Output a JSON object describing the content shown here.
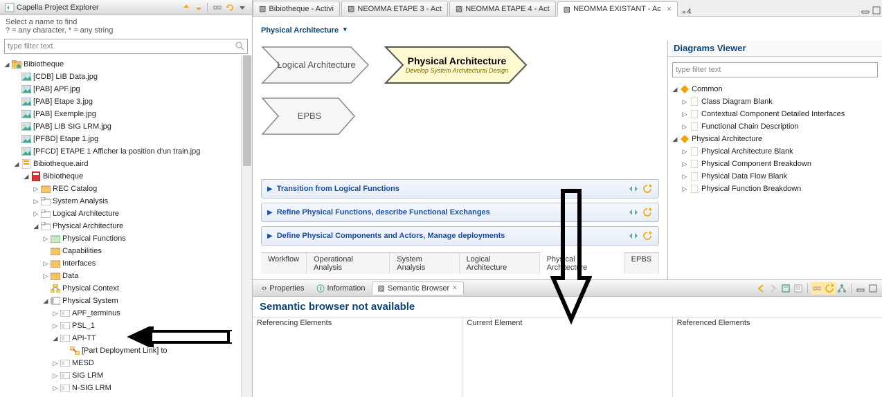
{
  "sidebar": {
    "title": "Capella Project Explorer",
    "help1": "Select a name to find",
    "help2": "? = any character, * = any string",
    "filter_placeholder": "type filter text",
    "tree": {
      "root": "Bibiotheque",
      "imgs": [
        "[CDB] LIB Data.jpg",
        "[PAB] APF.jpg",
        "[PAB] Etape 3.jpg",
        "[PAB] Exemple.jpg",
        "[PAB] LIB SIG LRM.jpg",
        "[PFBD] Etape 1.jpg",
        "[PFCD] ETAPE 1 Afficher la position d'un train.jpg"
      ],
      "aird": "Bibiotheque.aird",
      "model": "Bibiotheque",
      "rec": "REC Catalog",
      "sa": "System Analysis",
      "la": "Logical Architecture",
      "pa": "Physical Architecture",
      "pf": "Physical Functions",
      "cap": "Capabilities",
      "ifc": "Interfaces",
      "data": "Data",
      "pctx": "Physical Context",
      "psys": "Physical System",
      "apf": "APF_terminus",
      "psl": "PSL_1",
      "api": "API-TT",
      "pdl": "[Part Deployment Link] to",
      "mesd": "MESD",
      "sig": "SIG LRM",
      "nsig": "N-SIG LRM"
    }
  },
  "editor": {
    "tabs": [
      "Bibiotheque - Activi",
      "NEOMMA ETAPE 3 - Act",
      "NEOMMA ETAPE 4 - Act",
      "NEOMMA EXISTANT - Ac"
    ],
    "overflow": "4",
    "title": "Physical Architecture",
    "chevrons": {
      "logical": "Logical Architecture",
      "physical_t": "Physical Architecture",
      "physical_s": "Develop System Architectural Design",
      "epbs": "EPBS"
    },
    "acc": [
      "Transition from Logical Functions",
      "Refine Physical Functions, describe Functional Exchanges",
      "Define Physical Components and Actors, Manage deployments"
    ],
    "btabs": [
      "Workflow",
      "Operational Analysis",
      "System Analysis",
      "Logical Architecture",
      "Physical Architecture",
      "EPBS"
    ]
  },
  "diagrams": {
    "title": "Diagrams Viewer",
    "filter_placeholder": "type filter text",
    "common": "Common",
    "c1": "Class Diagram Blank",
    "c2": "Contextual Component Detailed Interfaces",
    "c3": "Functional Chain Description",
    "pa": "Physical Architecture",
    "p1": "Physical Architecture Blank",
    "p2": "Physical Component Breakdown",
    "p3": "Physical Data Flow Blank",
    "p4": "Physical Function Breakdown"
  },
  "views": {
    "props": "Properties",
    "info": "Information",
    "sb": "Semantic Browser",
    "sb_title": "Semantic browser not available",
    "col1": "Referencing Elements",
    "col2": "Current Element",
    "col3": "Referenced Elements"
  }
}
